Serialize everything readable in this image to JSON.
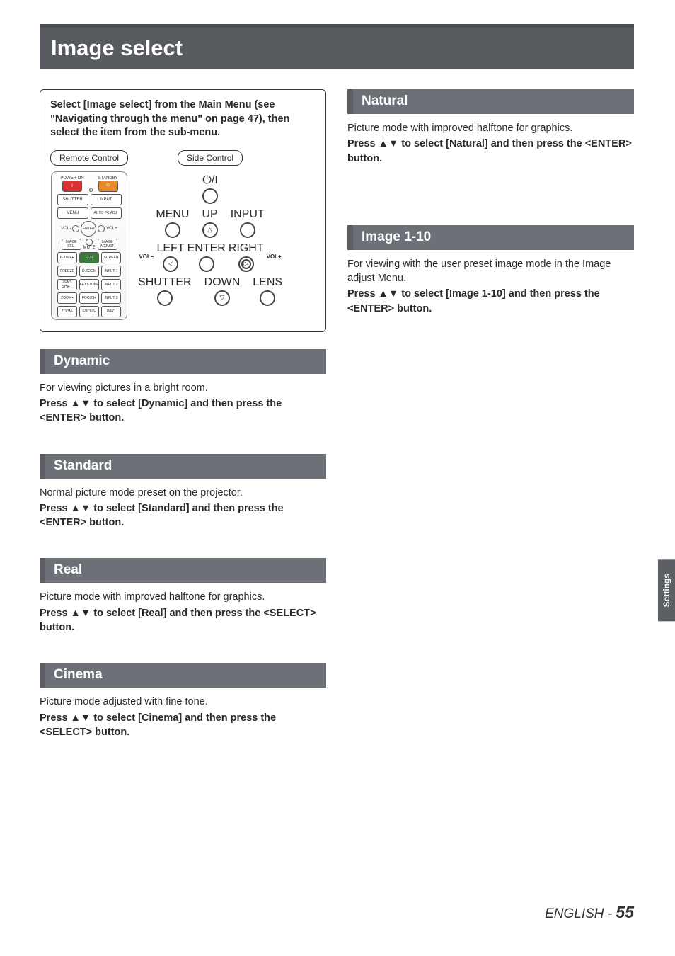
{
  "page": {
    "title": "Image select",
    "language_label": "ENGLISH - ",
    "page_number": "55",
    "side_tab": "Settings"
  },
  "instruction_box": {
    "lead": "Select [Image select] from the Main Menu (see \"Navigating through the menu\" on page 47), then select the item from the sub-menu.",
    "remote_label": "Remote Control",
    "side_label": "Side Control"
  },
  "remote_buttons": {
    "power_on": "POWER ON",
    "standby": "STANDBY",
    "shutter": "SHUTTER",
    "input": "INPUT",
    "menu": "MENU",
    "auto_pc": "AUTO PC ADJ.",
    "enter": "ENTER",
    "vol_minus": "VOL-",
    "vol_plus": "VOL+",
    "image_sel": "IMAGE SEL.",
    "mute": "MUTE",
    "image_adj": "IMAGE ADJUST",
    "ptimer": "P-TIMER",
    "eco": "ECO",
    "screen": "SCREEN",
    "freeze": "FREEZE",
    "dzoom": "D.ZOOM",
    "input1": "INPUT 1",
    "lenshift": "LENS SHIFT",
    "keystone": "KEYSTONE",
    "input2": "INPUT 2",
    "zoom_plus": "ZOOM+",
    "focus_plus": "FOCUS+",
    "input3": "INPUT 3",
    "zoom_minus": "ZOOM-",
    "focus_minus": "FOCUS-",
    "info": "INFO"
  },
  "side_buttons": {
    "power": "⏻/I",
    "menu": "MENU",
    "up": "UP",
    "input": "INPUT",
    "left": "LEFT",
    "enter": "ENTER",
    "right": "RIGHT",
    "vol_minus": "VOL−",
    "vol_plus": "VOL+",
    "shutter": "SHUTTER",
    "down": "DOWN",
    "lens": "LENS"
  },
  "sections": {
    "dynamic": {
      "heading": "Dynamic",
      "desc": "For viewing pictures in a bright room.",
      "action": "Press ▲▼ to select [Dynamic] and then press the <ENTER> button."
    },
    "standard": {
      "heading": "Standard",
      "desc": "Normal picture mode preset on the projector.",
      "action": "Press ▲▼ to select [Standard] and then press the <ENTER> button."
    },
    "real": {
      "heading": "Real",
      "desc": "Picture mode with improved halftone for graphics.",
      "action": "Press ▲▼ to select [Real] and then press the <SELECT> button."
    },
    "cinema": {
      "heading": "Cinema",
      "desc": "Picture mode adjusted with fine tone.",
      "action": "Press ▲▼ to select [Cinema] and then press the <SELECT> button."
    },
    "natural": {
      "heading": "Natural",
      "desc": "Picture mode with improved halftone for graphics.",
      "action": "Press ▲▼ to select [Natural] and then press the <ENTER> button."
    },
    "image110": {
      "heading": "Image 1-10",
      "desc": "For viewing with the user preset image mode in the Image adjust Menu.",
      "action": "Press ▲▼ to select [Image 1-10] and then press the <ENTER> button."
    }
  }
}
